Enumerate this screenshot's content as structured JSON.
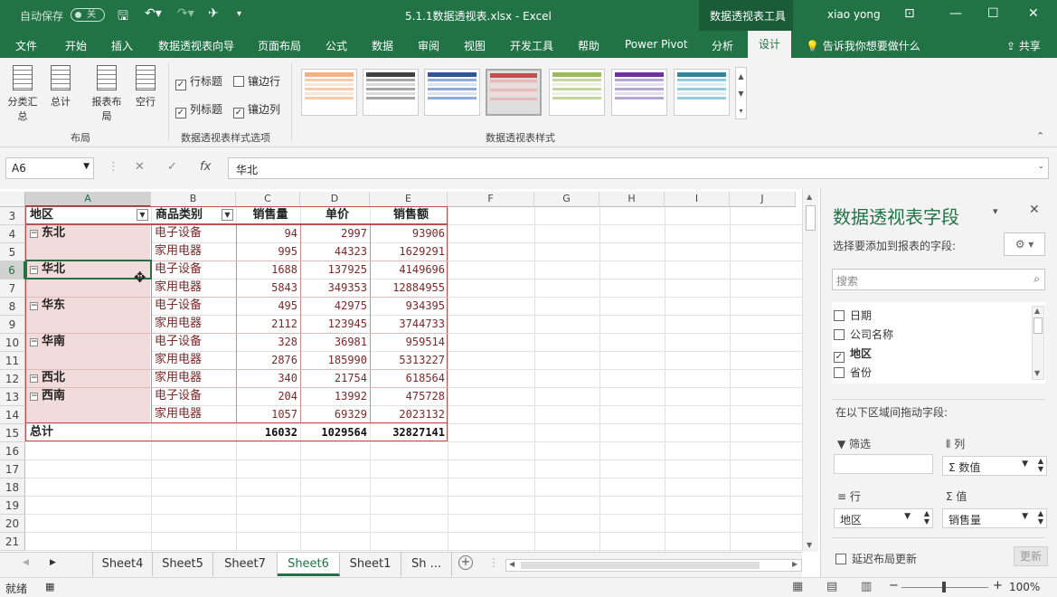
{
  "title": {
    "autosave": "自动保存",
    "toggle": "关",
    "filename": "5.1.1数据透视表.xlsx  -  Excel",
    "context_tool": "数据透视表工具",
    "user": "xiao yong"
  },
  "menu": {
    "items": [
      "文件",
      "开始",
      "插入",
      "数据透视表向导",
      "页面布局",
      "公式",
      "数据",
      "审阅",
      "视图",
      "开发工具",
      "帮助",
      "Power Pivot",
      "分析"
    ],
    "active": "设计",
    "tellme": "告诉我你想要做什么",
    "share": "共享"
  },
  "ribbon": {
    "layout_buttons": [
      "分类汇总",
      "总计",
      "报表布局",
      "空行"
    ],
    "layout_group": "布局",
    "options": {
      "row_headers": "行标题",
      "banded_rows": "镶边行",
      "col_headers": "列标题",
      "banded_cols": "镶边列"
    },
    "options_group": "数据透视表样式选项",
    "styles_group": "数据透视表样式"
  },
  "formula": {
    "name_box": "A6",
    "fx": "fx",
    "value": "华北"
  },
  "columns": [
    "A",
    "B",
    "C",
    "D",
    "E",
    "F",
    "G",
    "H",
    "I",
    "J"
  ],
  "rows": [
    "3",
    "4",
    "5",
    "6",
    "7",
    "8",
    "9",
    "10",
    "11",
    "12",
    "13",
    "14",
    "15",
    "16",
    "17",
    "18",
    "19",
    "20",
    "21"
  ],
  "pivot": {
    "headers": [
      "地区",
      "商品类别",
      "销售量",
      "单价",
      "销售额"
    ],
    "regions": [
      "东北",
      "华北",
      "华东",
      "华南",
      "西北",
      "西南"
    ],
    "data": [
      [
        "电子设备",
        "94",
        "2997",
        "93906"
      ],
      [
        "家用电器",
        "995",
        "44323",
        "1629291"
      ],
      [
        "电子设备",
        "1688",
        "137925",
        "4149696"
      ],
      [
        "家用电器",
        "5843",
        "349353",
        "12884955"
      ],
      [
        "电子设备",
        "495",
        "42975",
        "934395"
      ],
      [
        "家用电器",
        "2112",
        "123945",
        "3744733"
      ],
      [
        "电子设备",
        "328",
        "36981",
        "959514"
      ],
      [
        "家用电器",
        "2876",
        "185990",
        "5313227"
      ],
      [
        "家用电器",
        "340",
        "21754",
        "618564"
      ],
      [
        "电子设备",
        "204",
        "13992",
        "475728"
      ],
      [
        "家用电器",
        "1057",
        "69329",
        "2023132"
      ]
    ],
    "total": {
      "label": "总计",
      "qty": "16032",
      "price": "1029564",
      "amount": "32827141"
    }
  },
  "sheets": [
    "Sheet4",
    "Sheet5",
    "Sheet7",
    "Sheet6",
    "Sheet1",
    "Sh ..."
  ],
  "active_sheet": "Sheet6",
  "status": {
    "ready": "就绪",
    "zoom": "100%"
  },
  "pane": {
    "title": "数据透视表字段",
    "subtitle": "选择要添加到报表的字段:",
    "search_placeholder": "搜索",
    "fields": [
      {
        "name": "日期",
        "checked": false
      },
      {
        "name": "公司名称",
        "checked": false
      },
      {
        "name": "地区",
        "checked": true
      },
      {
        "name": "省份",
        "checked": false
      }
    ],
    "drag_hint": "在以下区域间拖动字段:",
    "filter": "筛选",
    "columns": "列",
    "columns_item": "数值",
    "rows": "行",
    "rows_item": "地区",
    "values": "值",
    "values_item": "销售量",
    "defer": "延迟布局更新",
    "update": "更新"
  },
  "colors": {
    "excel_green": "#217346",
    "pivot_border": "#c0504d",
    "pivot_fill": "#f2dcdb"
  }
}
